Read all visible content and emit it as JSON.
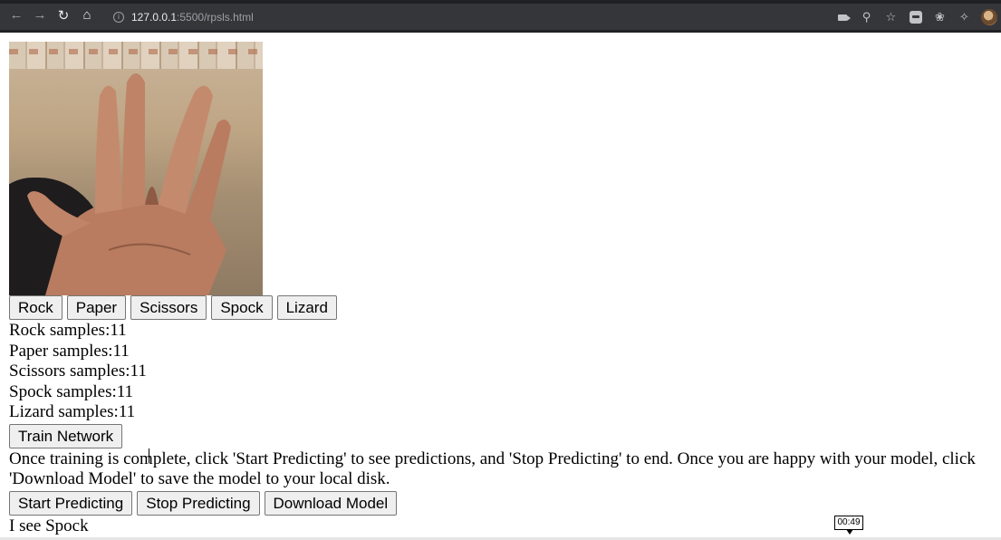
{
  "browser": {
    "url_host": "127.0.0.1",
    "url_path": ":5500/rpsls.html",
    "icons": [
      "back-arrow-icon",
      "forward-arrow-icon",
      "reload-icon",
      "home-icon",
      "info-icon",
      "camera-icon",
      "zoom-icon",
      "star-icon",
      "extension-icon",
      "leaf-extension-icon",
      "puzzle-icon",
      "profile-avatar"
    ]
  },
  "classes": {
    "buttons": [
      "Rock",
      "Paper",
      "Scissors",
      "Spock",
      "Lizard"
    ]
  },
  "counts": [
    {
      "text": "Rock samples:11"
    },
    {
      "text": "Paper samples:11"
    },
    {
      "text": "Scissors samples:11"
    },
    {
      "text": "Spock samples:11"
    },
    {
      "text": "Lizard samples:11"
    }
  ],
  "train": {
    "label": "Train Network"
  },
  "instructions": "Once training is complete, click 'Start Predicting' to see predictions, and 'Stop Predicting' to end. Once you are happy with your model, click 'Download Model' to save the model to your local disk.",
  "predict": {
    "start_label": "Start Predicting",
    "stop_label": "Stop Predicting",
    "download_label": "Download Model"
  },
  "result": "I see Spock",
  "overlay": {
    "timestamp": "00:49"
  }
}
